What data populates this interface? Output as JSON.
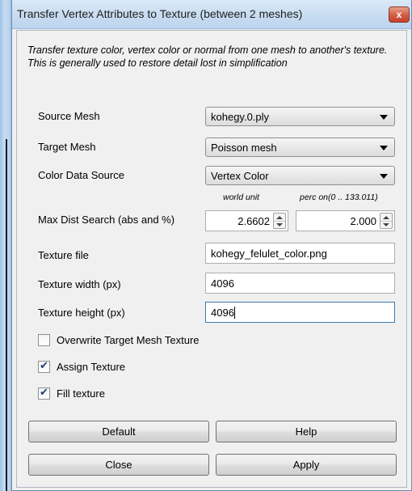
{
  "window": {
    "title": "Transfer Vertex Attributes to Texture (between 2 meshes)",
    "close_glyph": "x"
  },
  "description": "Transfer texture color, vertex color or normal from one mesh to another's texture. This is generally used to restore detail lost in simplification",
  "params": {
    "source_mesh": {
      "label": "Source Mesh",
      "value": "kohegy.0.ply"
    },
    "target_mesh": {
      "label": "Target Mesh",
      "value": "Poisson mesh"
    },
    "color_source": {
      "label": "Color Data Source",
      "value": "Vertex Color"
    },
    "max_dist": {
      "label": "Max Dist Search (abs and %)",
      "abs_caption": "world unit",
      "perc_caption": "perc on(0 .. 133.011)",
      "abs_value": "2.6602",
      "perc_value": "2.000"
    },
    "texture_file": {
      "label": "Texture file",
      "value": "kohegy_felulet_color.png"
    },
    "texture_width": {
      "label": "Texture width (px)",
      "value": "4096"
    },
    "texture_height": {
      "label": "Texture height (px)",
      "value": "4096"
    }
  },
  "checkboxes": {
    "overwrite": {
      "label": "Overwrite Target Mesh Texture",
      "checked": false
    },
    "assign": {
      "label": "Assign Texture",
      "checked": true
    },
    "fill": {
      "label": "Fill texture",
      "checked": true
    }
  },
  "check_glyph": "✔",
  "buttons": {
    "default": "Default",
    "help": "Help",
    "close": "Close",
    "apply": "Apply"
  }
}
